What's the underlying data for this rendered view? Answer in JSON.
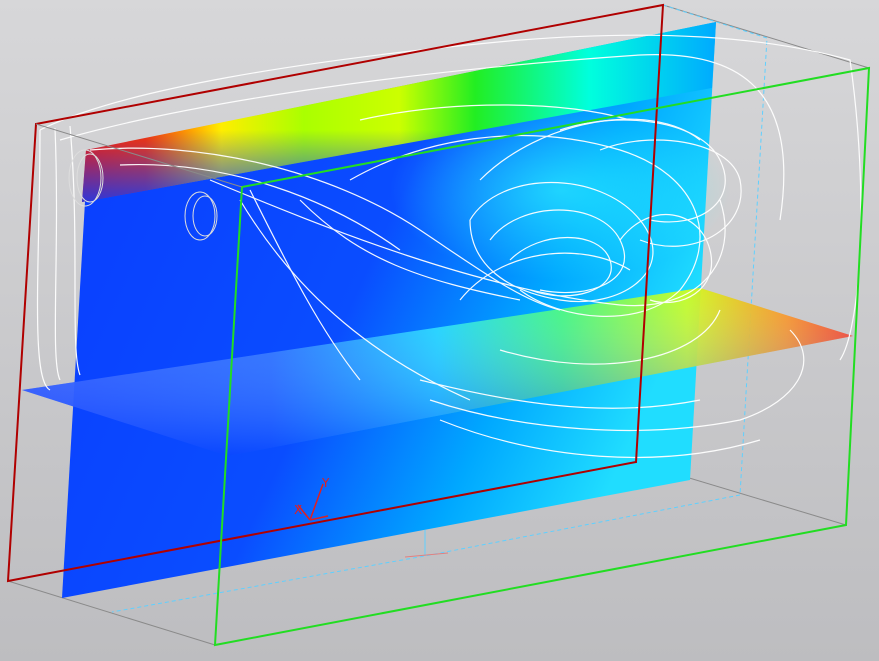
{
  "scene": {
    "description_labels": {
      "axis_y": "Y",
      "axis_x": "X"
    },
    "colors": {
      "background_top": "#d7d7d9",
      "background_bottom": "#bdbdc0",
      "frame_red": "#b00000",
      "frame_green": "#22dd22",
      "frame_gray": "#8a8a8a",
      "frame_cyan": "#5fd0ff",
      "streamline": "#ffffff",
      "contour_low": "#0a3cff",
      "contour_mid": "#00ffff",
      "contour_green": "#00dd00",
      "contour_yellow": "#ffff00",
      "contour_high": "#ff1a00"
    }
  }
}
